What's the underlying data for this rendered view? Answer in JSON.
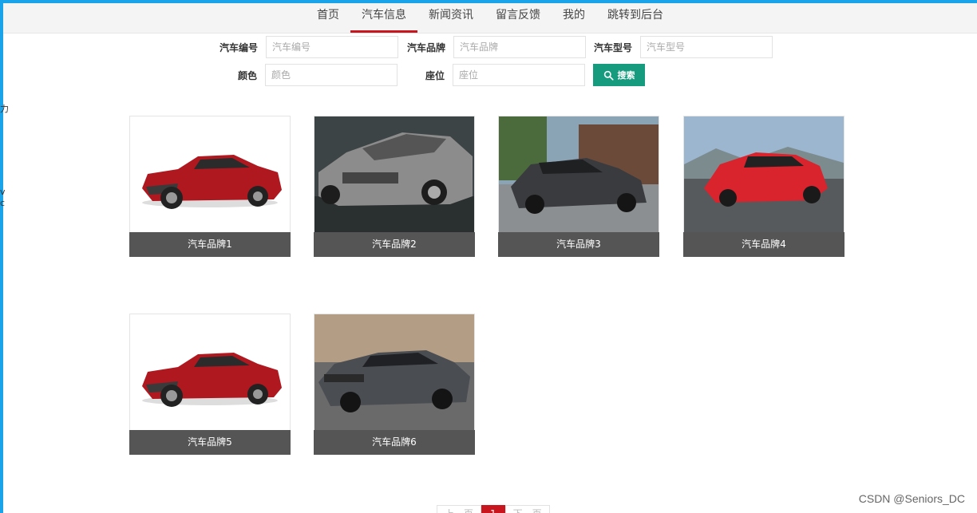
{
  "nav": {
    "items": [
      {
        "label": "首页",
        "active": false
      },
      {
        "label": "汽车信息",
        "active": true
      },
      {
        "label": "新闻资讯",
        "active": false
      },
      {
        "label": "留言反馈",
        "active": false
      },
      {
        "label": "我的",
        "active": false
      },
      {
        "label": "跳转到后台",
        "active": false
      }
    ]
  },
  "search": {
    "fields": [
      {
        "label": "汽车编号",
        "placeholder": "汽车编号",
        "value": ""
      },
      {
        "label": "汽车品牌",
        "placeholder": "汽车品牌",
        "value": ""
      },
      {
        "label": "汽车型号",
        "placeholder": "汽车型号",
        "value": ""
      },
      {
        "label": "颜色",
        "placeholder": "颜色",
        "value": ""
      },
      {
        "label": "座位",
        "placeholder": "座位",
        "value": ""
      }
    ],
    "button_label": "搜索",
    "button_color": "#169b7e"
  },
  "cars": [
    {
      "name": "汽车品牌1"
    },
    {
      "name": "汽车品牌2"
    },
    {
      "name": "汽车品牌3"
    },
    {
      "name": "汽车品牌4"
    },
    {
      "name": "汽车品牌5"
    },
    {
      "name": "汽车品牌6"
    }
  ],
  "pagination": {
    "prev": "上一页",
    "current": "1",
    "next": "下一页"
  },
  "left_edge": {
    "glyph1": "力",
    "glyph2": "v",
    "glyph3": "c"
  },
  "watermark": "CSDN @Seniors_DC",
  "colors": {
    "accent_red": "#c9151e",
    "top_border": "#1aa3e8",
    "caption_bg": "#555555"
  }
}
